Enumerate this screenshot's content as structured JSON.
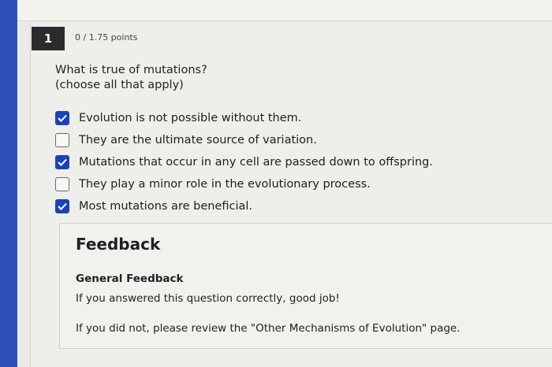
{
  "question": {
    "number": "1",
    "points": "0 / 1.75 points",
    "prompt_line1": "What is true of mutations?",
    "prompt_line2": "(choose all that apply)",
    "options": [
      {
        "label": "Evolution is not possible without them.",
        "checked": true
      },
      {
        "label": "They are the ultimate source of variation.",
        "checked": false
      },
      {
        "label": "Mutations that occur in any cell are passed down to offspring.",
        "checked": true
      },
      {
        "label": "They play a minor role in the evolutionary process.",
        "checked": false
      },
      {
        "label": "Most mutations are beneficial.",
        "checked": true
      }
    ]
  },
  "feedback": {
    "title": "Feedback",
    "subtitle": "General Feedback",
    "line1": "If you answered this question correctly, good job!",
    "line2": "If you did not, please review the \"Other Mechanisms of Evolution\" page."
  },
  "colors": {
    "accent": "#1a44b5",
    "sidebar": "#2f4eb8",
    "question_badge": "#2b2b2d"
  }
}
